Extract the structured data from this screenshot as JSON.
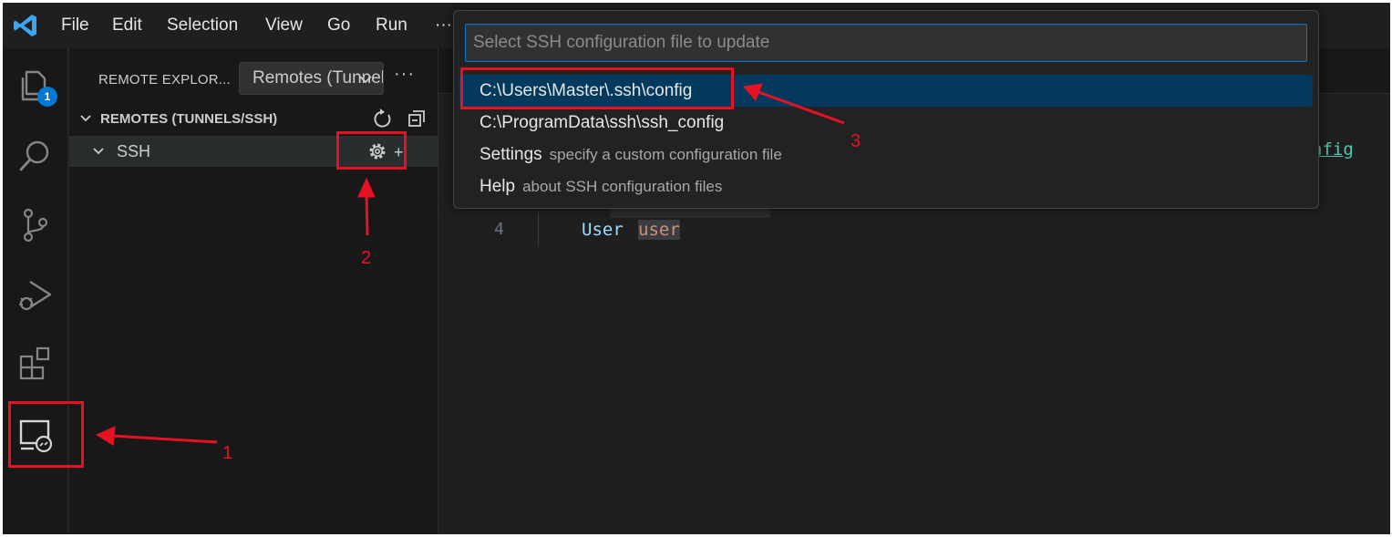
{
  "menu": {
    "items": [
      "File",
      "Edit",
      "Selection",
      "View",
      "Go",
      "Run"
    ],
    "more": "···"
  },
  "activity_bar": {
    "explorer_badge": "1",
    "icons": [
      "files-icon",
      "search-icon",
      "source-control-icon",
      "run-debug-icon",
      "extensions-icon",
      "remote-explorer-icon"
    ]
  },
  "sidebar": {
    "title": "REMOTE EXPLOR...",
    "dropdown_value": "Remotes (Tunnels/SSH)",
    "more": "···",
    "section_label": "REMOTES (TUNNELS/SSH)",
    "ssh_label": "SSH",
    "new_remote": "+"
  },
  "editor": {
    "line_number": "4",
    "keyword": "User",
    "value": "user",
    "link_fragment": "nfig"
  },
  "quick_pick": {
    "placeholder": "Select SSH configuration file to update",
    "items": [
      {
        "label": "C:\\Users\\Master\\.ssh\\config",
        "description": ""
      },
      {
        "label": "C:\\ProgramData\\ssh\\ssh_config",
        "description": ""
      },
      {
        "label": "Settings",
        "description": "specify a custom configuration file"
      },
      {
        "label": "Help",
        "description": "about SSH configuration files"
      }
    ]
  },
  "annotations": {
    "steps": [
      "1",
      "2",
      "3"
    ],
    "color": "#e81123"
  },
  "colors": {
    "accent": "#0078d4",
    "selection": "#04395e",
    "background": "#1f1f1f"
  }
}
